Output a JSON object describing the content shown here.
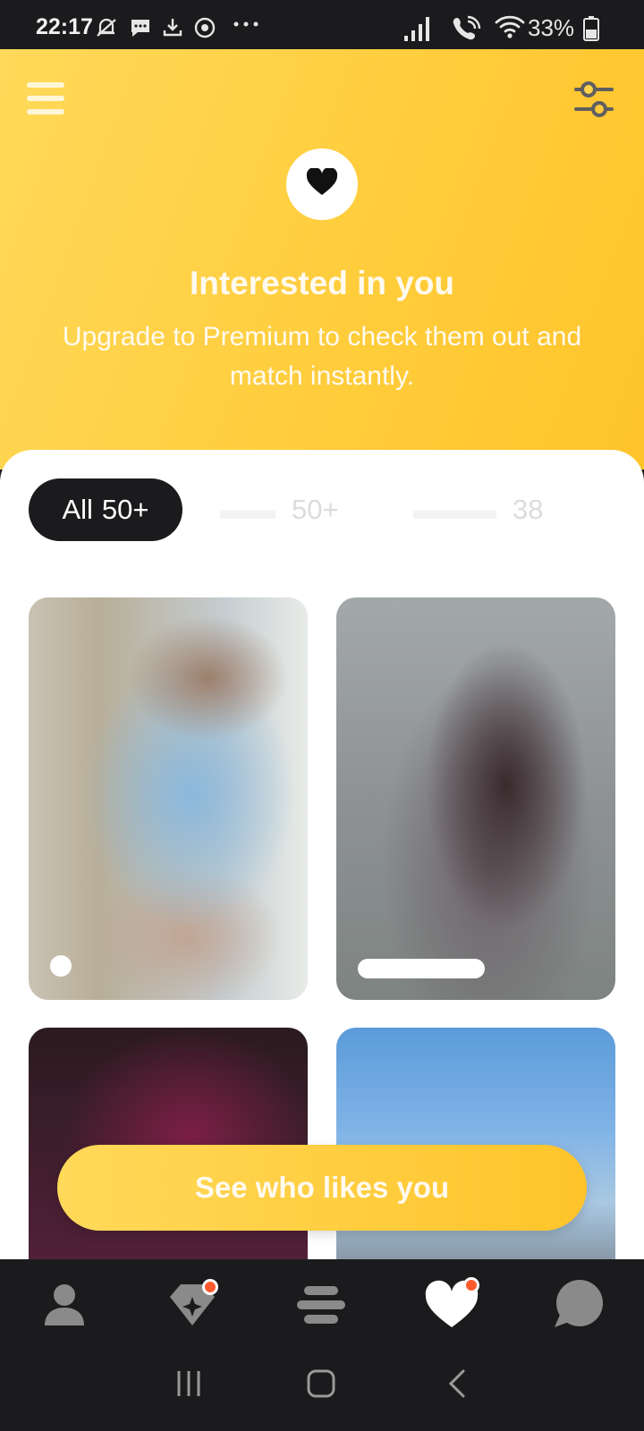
{
  "status_bar": {
    "time": "22:17",
    "battery_percent": "33%",
    "icons": [
      "mute-bell-icon",
      "message-icon",
      "download-icon",
      "chrome-icon",
      "more-dots-icon",
      "signal-icon",
      "wifi-calling-icon",
      "wifi-icon",
      "battery-icon"
    ]
  },
  "header": {
    "title": "Interested in you",
    "subtitle": "Upgrade to Premium to check them out and match instantly.",
    "gradient_start": "#ffd95a",
    "gradient_end": "#ffc42a"
  },
  "filters": [
    {
      "label": "All",
      "count": "50+",
      "active": true
    },
    {
      "label": "",
      "count": "50+",
      "active": false
    },
    {
      "label": "",
      "count": "38",
      "active": false
    }
  ],
  "cards": [
    {
      "blurred": true
    },
    {
      "blurred": true
    },
    {
      "blurred": true
    },
    {
      "blurred": true
    }
  ],
  "cta": {
    "label": "See who likes you"
  },
  "bottom_nav": [
    {
      "icon": "profile-icon",
      "active": false,
      "badge": false
    },
    {
      "icon": "sparkle-diamond-icon",
      "active": false,
      "badge": true
    },
    {
      "icon": "discover-stack-icon",
      "active": false,
      "badge": false
    },
    {
      "icon": "heart-icon",
      "active": true,
      "badge": true
    },
    {
      "icon": "chat-bubble-icon",
      "active": false,
      "badge": false
    }
  ],
  "colors": {
    "accent": "#ffcd3c",
    "dark": "#1b1b1d",
    "badge": "#ff5a2e"
  }
}
